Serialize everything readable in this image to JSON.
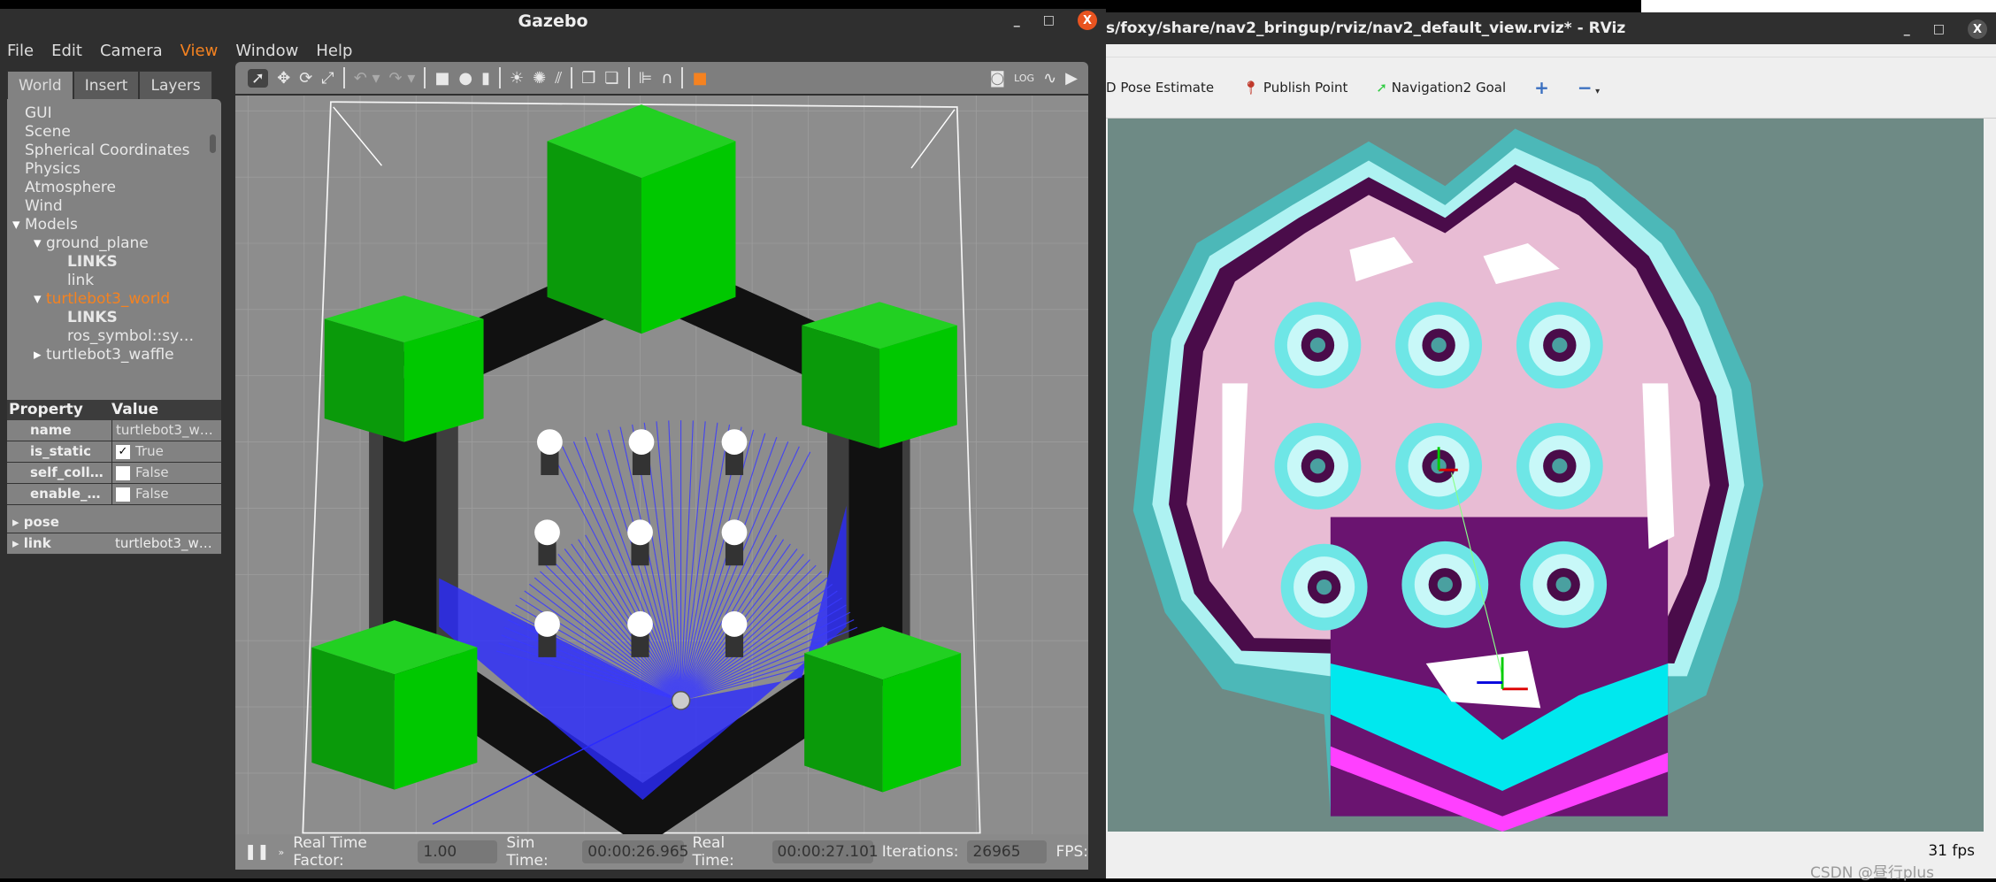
{
  "gazebo": {
    "title": "Gazebo",
    "window_controls": {
      "minimize": "_",
      "maximize": "□",
      "close": "X"
    },
    "menu": [
      "File",
      "Edit",
      "Camera",
      "View",
      "Window",
      "Help"
    ],
    "active_menu": "View",
    "tabs": [
      "World",
      "Insert",
      "Layers"
    ],
    "tree": [
      {
        "label": "GUI",
        "indent": 0
      },
      {
        "label": "Scene",
        "indent": 0
      },
      {
        "label": "Spherical Coordinates",
        "indent": 0
      },
      {
        "label": "Physics",
        "indent": 0
      },
      {
        "label": "Atmosphere",
        "indent": 0
      },
      {
        "label": "Wind",
        "indent": 0
      },
      {
        "label": "Models",
        "indent": 0,
        "expander": "▾"
      },
      {
        "label": "ground_plane",
        "indent": 1,
        "expander": "▾"
      },
      {
        "label": "LINKS",
        "indent": 2,
        "bold": true
      },
      {
        "label": "link",
        "indent": 2
      },
      {
        "label": "turtlebot3_world",
        "indent": 1,
        "expander": "▾",
        "selected": true
      },
      {
        "label": "LINKS",
        "indent": 2,
        "bold": true
      },
      {
        "label": "ros_symbol::sy…",
        "indent": 2
      },
      {
        "label": "turtlebot3_waffle",
        "indent": 1,
        "expander": "▸"
      }
    ],
    "properties": {
      "header": [
        "Property",
        "Value"
      ],
      "rows": [
        {
          "key": "name",
          "value": "turtlebot3_w…"
        },
        {
          "key": "is_static",
          "value": "True",
          "checked": true
        },
        {
          "key": "self_coll…",
          "value": "False",
          "checked": false
        },
        {
          "key": "enable_…",
          "value": "False",
          "checked": false
        }
      ],
      "groups": [
        {
          "key": "pose",
          "value": ""
        },
        {
          "key": "link",
          "value": "turtlebot3_w…"
        }
      ]
    },
    "status": {
      "pause_icon": "pause-icon",
      "rtf_label": "Real Time Factor:",
      "rtf": "1.00",
      "sim_label": "Sim Time:",
      "sim": "00:00:26.965",
      "real_label": "Real Time:",
      "real": "00:00:27.101",
      "iter_label": "Iterations:",
      "iter": "26965",
      "fps_label": "FPS:"
    },
    "colors": {
      "accent": "#f58220",
      "cube": "#00c000",
      "wall": "#111111",
      "laser": "#2020ff"
    }
  },
  "rviz": {
    "title": "s/foxy/share/nav2_bringup/rviz/nav2_default_view.rviz* - RViz",
    "window_controls": {
      "minimize": "_",
      "maximize": "□",
      "close": "X"
    },
    "tools": [
      {
        "label": "D Pose Estimate",
        "icon": "pose-estimate-icon"
      },
      {
        "label": "Publish Point",
        "icon": "map-pin-icon"
      },
      {
        "label": "Navigation2 Goal",
        "icon": "goal-arrow-icon"
      }
    ],
    "add_icon": "+",
    "remove_icon": "−",
    "fps": "31 fps",
    "watermark": "CSDN @昼行plus"
  }
}
